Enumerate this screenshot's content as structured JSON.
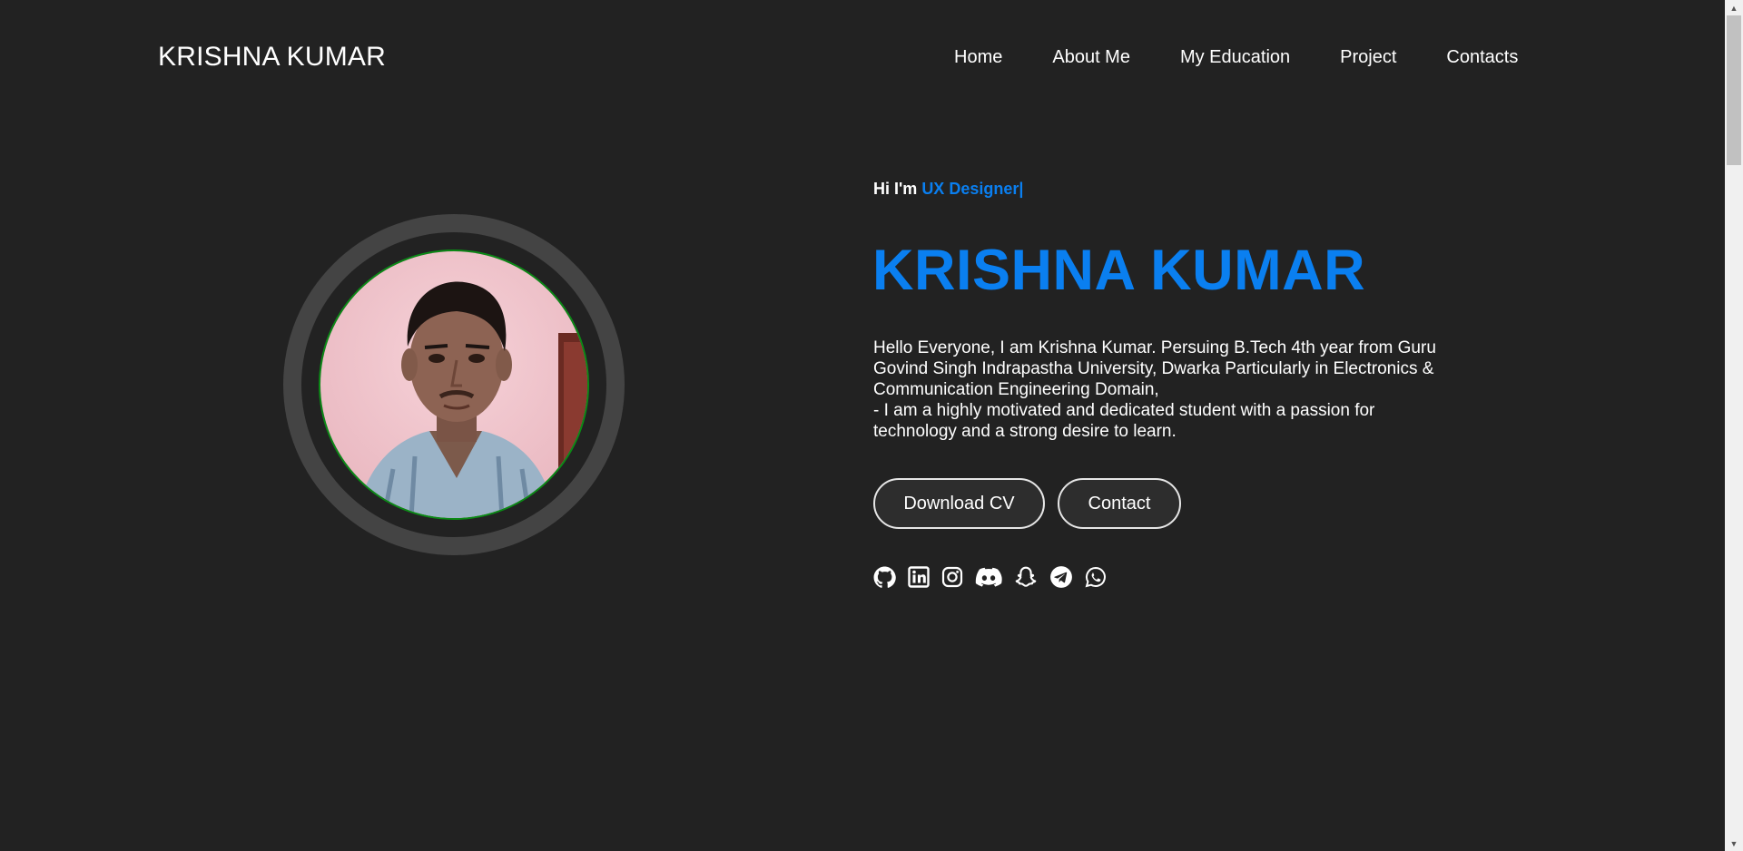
{
  "header": {
    "logo": "KRISHNA KUMAR",
    "nav": [
      "Home",
      "About Me",
      "My Education",
      "Project",
      "Contacts"
    ]
  },
  "hero": {
    "greeting": "Hi I'm",
    "role": "UX Designer|",
    "name": "KRISHNA KUMAR",
    "bio": [
      "Hello Everyone, I am Krishna Kumar. Persuing B.Tech 4th year from Guru Govind Singh Indrapastha University, Dwarka Particularly in Electronics & Communication Engineering Domain,",
      "- I am a highly motivated and dedicated student with a passion for technology and a strong desire to learn."
    ],
    "buttons": {
      "download": "Download CV",
      "contact": "Contact"
    },
    "socials": [
      "github-icon",
      "linkedin-icon",
      "instagram-icon",
      "discord-icon",
      "snapchat-icon",
      "telegram-icon",
      "whatsapp-icon"
    ]
  },
  "colors": {
    "background": "#222222",
    "accent": "#0a7ff0",
    "ring": "#444444",
    "photo_border": "#0b8a16"
  }
}
